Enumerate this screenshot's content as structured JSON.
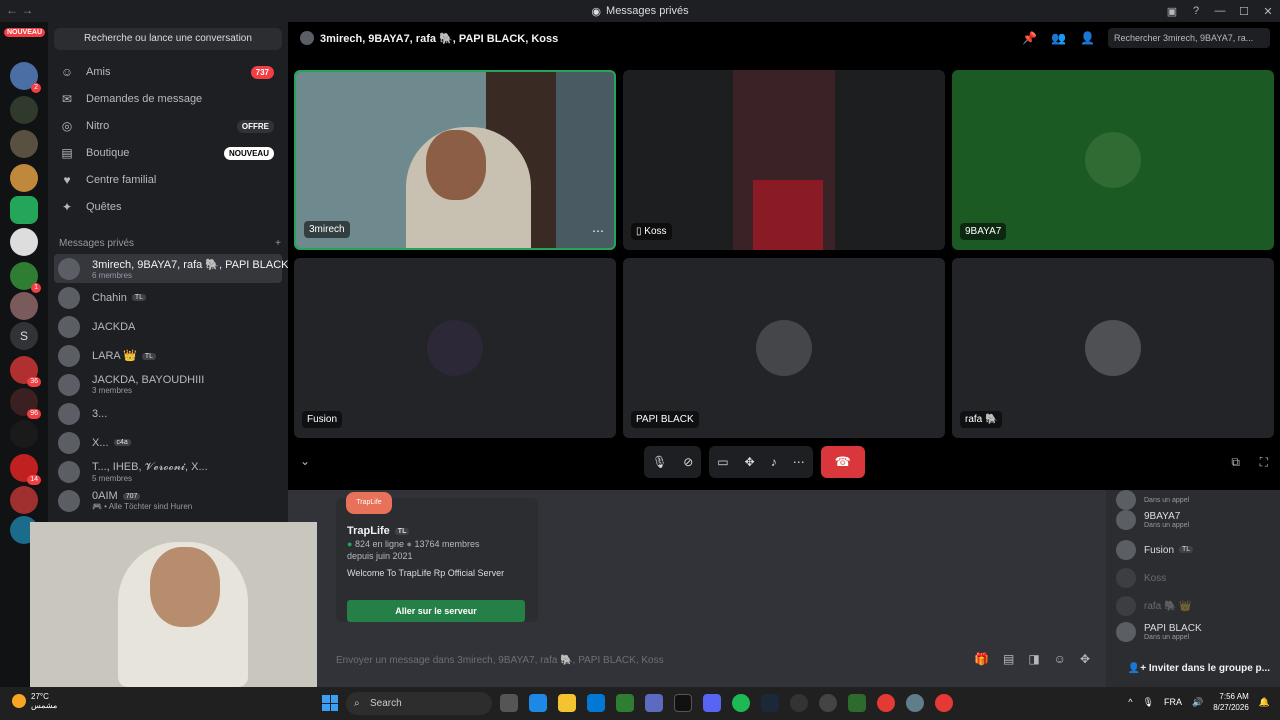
{
  "window": {
    "title": "Messages privés"
  },
  "servers": {
    "new_label": "NOUVEAU",
    "letter": "S"
  },
  "sidebar": {
    "search_label": "Recherche ou lance une conversation",
    "nav": [
      {
        "label": "Amis",
        "badge": "737",
        "icon": "friends-icon"
      },
      {
        "label": "Demandes de message",
        "badge": "",
        "icon": "mail-icon"
      },
      {
        "label": "Nitro",
        "badge": "OFFRE",
        "icon": "nitro-icon"
      },
      {
        "label": "Boutique",
        "badge": "NOUVEAU",
        "icon": "shop-icon"
      },
      {
        "label": "Centre familial",
        "badge": "",
        "icon": "family-icon"
      },
      {
        "label": "Quêtes",
        "badge": "",
        "icon": "quests-icon"
      }
    ],
    "dm_header": "Messages privés",
    "dms": [
      {
        "name": "3mirech, 9BAYA7, rafa 🐘, PAPI BLACK,...",
        "sub": "6 membres"
      },
      {
        "name": "Chahin",
        "tag": "TL"
      },
      {
        "name": "JACKDA"
      },
      {
        "name": "LARA 👑",
        "tag": "TL"
      },
      {
        "name": "JACKDA, BAYOUDHIII",
        "sub": "3 membres"
      },
      {
        "name": "3..."
      },
      {
        "name": "X...",
        "tag": "c4a"
      },
      {
        "name": "T..., IHEB, 𝓥𝓮𝓻𝓸𝓸𝓷𝓲, X...",
        "sub": "5 membres"
      },
      {
        "name": "0AIM",
        "tag": "707",
        "sub": "🎮 • Alle Töchter sind Huren"
      }
    ]
  },
  "call": {
    "header_title": "3mirech, 9BAYA7, rafa 🐘, PAPI BLACK, Koss",
    "search_placeholder": "Rechercher 3mirech, 9BAYA7, ra...",
    "tiles": [
      {
        "name": "3mirech"
      },
      {
        "name": "Koss"
      },
      {
        "name": "9BAYA7"
      },
      {
        "name": "Fusion"
      },
      {
        "name": "PAPI BLACK"
      },
      {
        "name": "rafa 🐘"
      }
    ]
  },
  "chat": {
    "server_card": {
      "logo_text": "TrapLife",
      "name": "TrapLife",
      "tag": "TL",
      "online": "824 en ligne",
      "members": "13764 membres",
      "since": "depuis juin 2021",
      "description": "Welcome To TrapLife Rp Official Server",
      "join_label": "Aller sur le serveur"
    },
    "input_placeholder": "Envoyer un message dans 3mirech, 9BAYA7, rafa 🐘, PAPI BLACK, Koss"
  },
  "members_panel": {
    "members": [
      {
        "name": "",
        "status": "Dans un appel"
      },
      {
        "name": "9BAYA7",
        "status": "Dans un appel"
      },
      {
        "name": "Fusion",
        "tag": "TL",
        "status": ""
      },
      {
        "name": "Koss",
        "status": ""
      },
      {
        "name": "rafa 🐘 👑",
        "status": ""
      },
      {
        "name": "PAPI BLACK",
        "status": "Dans un appel"
      }
    ],
    "invite_label": "Inviter dans le groupe p..."
  },
  "taskbar": {
    "temp": "27°C",
    "weather_text": "مشمس",
    "search_label": "Search",
    "lang": "FRA",
    "time": "7:56 AM",
    "date": "8/27/2026"
  },
  "colors": {
    "accent": "#5865f2",
    "danger": "#da373c",
    "success": "#248046"
  }
}
